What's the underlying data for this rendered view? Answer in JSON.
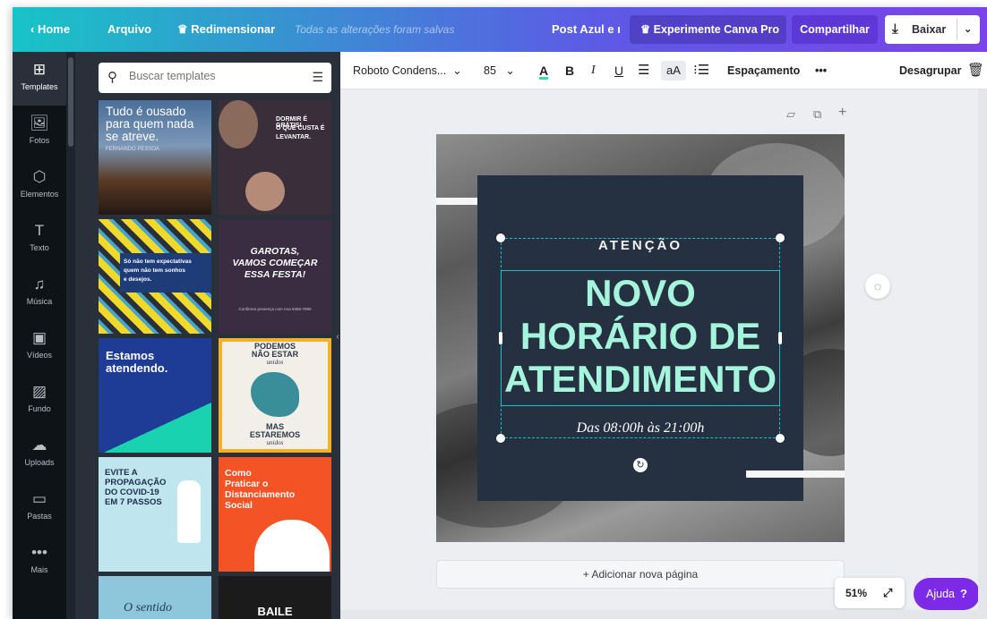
{
  "topbar": {
    "home": "‹  Home",
    "arquivo": "Arquivo",
    "redimensionar": "♛ Redimensionar",
    "saved_status": "Todas as alterações foram salvas",
    "design_title": "Post Azul e ı",
    "pro": "♛ Experimente Canva Pro",
    "share": "Compartilhar",
    "download": "Baixar"
  },
  "rail": [
    {
      "label": "Templates",
      "icon": "⊞"
    },
    {
      "label": "Fotos",
      "icon": "🖼"
    },
    {
      "label": "Elementos",
      "icon": "⬡"
    },
    {
      "label": "Texto",
      "icon": "T"
    },
    {
      "label": "Música",
      "icon": "♫"
    },
    {
      "label": "Vídeos",
      "icon": "▣"
    },
    {
      "label": "Fundo",
      "icon": "▨"
    },
    {
      "label": "Uploads",
      "icon": "☁"
    },
    {
      "label": "Pastas",
      "icon": "▭"
    },
    {
      "label": "Mais",
      "icon": "•••"
    }
  ],
  "search": {
    "placeholder": "Buscar templates"
  },
  "templates": {
    "t1": {
      "line1": "Tudo é ousado",
      "line2": "para quem nada",
      "line3": "se atreve.",
      "author": "FERNANDO PESSOA"
    },
    "t2": {
      "line1": "DORMIR É GRÁTIS!",
      "line2": "O QUE CUSTA É",
      "line3": "LEVANTAR."
    },
    "t3": {
      "line1": "Só não tem expectativas",
      "line2": "quem não tem sonhos",
      "line3": "e desejos."
    },
    "t4": {
      "line1": "GAROTAS,",
      "line2": "VAMOS COMEÇAR",
      "line3": "ESSA FESTA!",
      "footer": "Confirmar presença com Ana 9456-7890"
    },
    "t5": {
      "line1": "Estamos",
      "line2": "atendendo."
    },
    "t6": {
      "line1": "PODEMOS",
      "line2": "NÃO ESTAR",
      "line3": "unidos",
      "line4": "MAS",
      "line5": "ESTAREMOS",
      "line6": "unidos"
    },
    "t7": {
      "line1": "EVITE A",
      "line2": "PROPAGAÇÃO",
      "line3": "DO COVID-19",
      "line4": "EM 7 PASSOS"
    },
    "t8": {
      "line1": "Como",
      "line2": "Praticar o",
      "line3": "Distanciamento",
      "line4": "Social"
    },
    "t9": {
      "line1": "O sentido"
    },
    "t10": {
      "line1": "BAILE"
    }
  },
  "toolbar": {
    "font": "Roboto Condens...",
    "size": "85",
    "bold": "B",
    "italic": "I",
    "underline": "U",
    "case": "aA",
    "spacing": "Espaçamento",
    "more": "•••",
    "ungroup": "Desagrupar"
  },
  "design": {
    "attention": "ATENÇÃO",
    "headline1": "NOVO",
    "headline2": "HORÁRIO DE",
    "headline3": "ATENDIMENTO",
    "hours": "Das 08:00h às 21:00h"
  },
  "canvas": {
    "add_page": "+ Adicionar nova página",
    "zoom": "51%",
    "help": "Ajuda",
    "help_q": "?"
  },
  "colors": {
    "accent_purple": "#7d2ae8",
    "card_navy": "#253041",
    "headline_mint": "#a5f5dc",
    "selection_cyan": "#13c4d0"
  }
}
